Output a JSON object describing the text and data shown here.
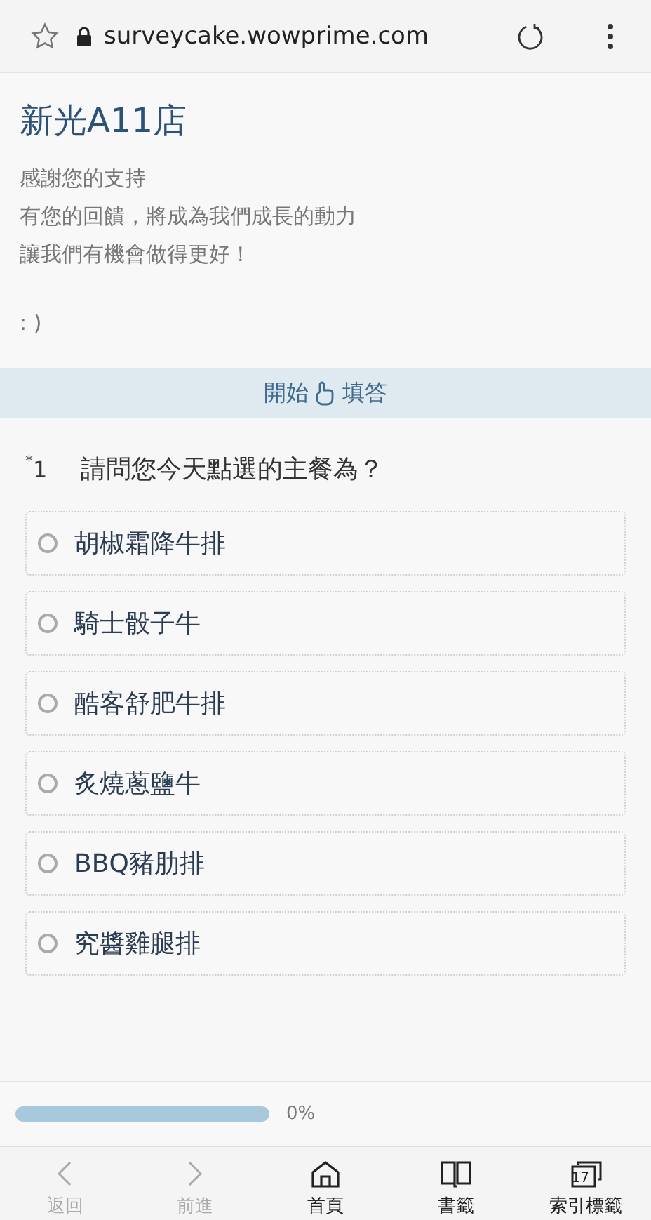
{
  "address_bar": {
    "url": "surveycake.wowprime.com"
  },
  "header": {
    "title": "新光A11店",
    "lines": [
      "感謝您的支持",
      "有您的回饋，將成為我們成長的動力",
      "讓我們有機會做得更好！"
    ],
    "smiley": ":  )"
  },
  "start_bar": {
    "before": "開始",
    "after": "填答"
  },
  "question": {
    "required_mark": "*",
    "number": "1",
    "text": "請問您今天點選的主餐為？",
    "options": [
      {
        "label": "胡椒霜降牛排",
        "selected": false
      },
      {
        "label": "騎士骰子牛",
        "selected": false
      },
      {
        "label": "酷客舒肥牛排",
        "selected": false
      },
      {
        "label": "炙燒蔥鹽牛",
        "selected": false
      },
      {
        "label": "BBQ豬肋排",
        "selected": false
      },
      {
        "label": "究醬雞腿排",
        "selected": false
      }
    ]
  },
  "progress": {
    "level": 0,
    "reading": "0%"
  },
  "bottom_nav": [
    {
      "kind": "back",
      "label": "返回",
      "disabled": true
    },
    {
      "kind": "forward",
      "label": "前進",
      "disabled": true
    },
    {
      "kind": "home",
      "label": "首頁",
      "disabled": false
    },
    {
      "kind": "bookmarks",
      "label": "書籤",
      "disabled": false
    },
    {
      "kind": "tabs",
      "label": "索引標籤",
      "disabled": false,
      "count": "17"
    }
  ]
}
